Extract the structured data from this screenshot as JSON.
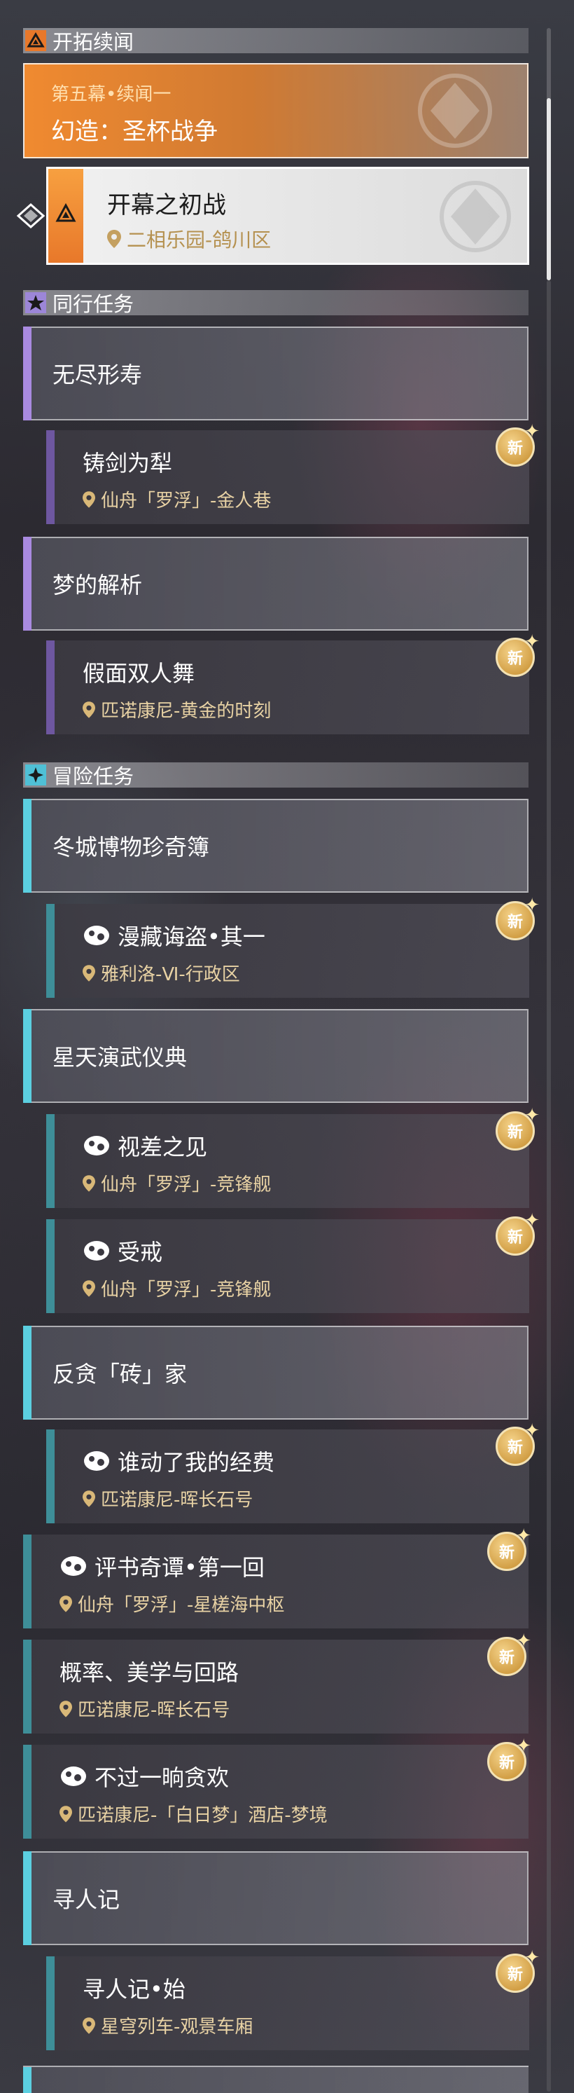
{
  "sections": {
    "trailblaze": "开拓续闻",
    "companion": "同行任务",
    "adventure": "冒险任务"
  },
  "main_quest": {
    "chapter": "第五幕•续闻一",
    "title": "幻造：圣杯战争",
    "sub_title": "开幕之初战",
    "sub_location": "二相乐园-鸽川区"
  },
  "companion_groups": [
    {
      "title": "无尽形寿",
      "quest": "铸剑为犁",
      "location": "仙舟「罗浮」-金人巷",
      "badge": "新"
    },
    {
      "title": "梦的解析",
      "quest": "假面双人舞",
      "location": "匹诺康尼-黄金的时刻",
      "badge": "新"
    }
  ],
  "adventure": {
    "group1": {
      "title": "冬城博物珍奇簿",
      "quest": "漫藏诲盗•其一",
      "location": "雅利洛-Ⅵ-行政区",
      "badge": "新"
    },
    "group2": {
      "title": "星天演武仪典",
      "quests": [
        {
          "quest": "视差之见",
          "location": "仙舟「罗浮」-竞锋舰",
          "badge": "新"
        },
        {
          "quest": "受戒",
          "location": "仙舟「罗浮」-竞锋舰",
          "badge": "新"
        }
      ]
    },
    "group3": {
      "title": "反贪「砖」家",
      "quest": "谁动了我的经费",
      "location": "匹诺康尼-晖长石号",
      "badge": "新"
    },
    "standalone": [
      {
        "quest": "评书奇谭•第一回",
        "location": "仙舟「罗浮」-星槎海中枢",
        "badge": "新"
      },
      {
        "quest": "概率、美学与回路",
        "location": "匹诺康尼-晖长石号",
        "badge": "新"
      },
      {
        "quest": "不过一晌贪欢",
        "location": "匹诺康尼-「白日梦」酒店-梦境",
        "badge": "新"
      }
    ],
    "group4": {
      "title": "寻人记",
      "quest": "寻人记•始",
      "location": "星穹列车-观景车厢",
      "badge": "新"
    }
  },
  "colors": {
    "main_accent": "#f08a30",
    "companion_accent": "#a98ae0",
    "adventure_accent": "#5bcfe0",
    "location_text": "#e8d2a4",
    "badge": "#d9a23a"
  },
  "icons": [
    "trailblaze-icon",
    "companion-star-icon",
    "adventure-compass-icon",
    "location-pin-icon",
    "adventure-quest-icon",
    "new-badge-icon",
    "selected-arrow-icon"
  ]
}
